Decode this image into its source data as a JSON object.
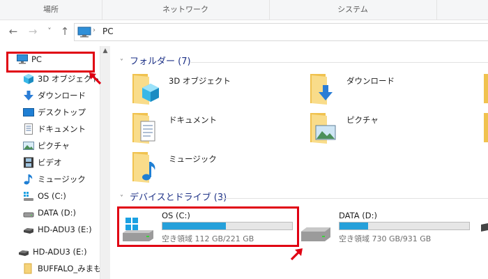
{
  "ribbon": {
    "tabs": [
      "場所",
      "ネットワーク",
      "システム"
    ]
  },
  "address": {
    "back_icon": "←",
    "forward_icon": "→",
    "history_icon": "˅",
    "up_icon": "↑",
    "path": "PC"
  },
  "sidebar": {
    "items": [
      {
        "label": "PC",
        "icon": "monitor-icon"
      },
      {
        "label": "3D オブジェクト",
        "icon": "cube-icon"
      },
      {
        "label": "ダウンロード",
        "icon": "download-arrow-icon"
      },
      {
        "label": "デスクトップ",
        "icon": "desktop-icon"
      },
      {
        "label": "ドキュメント",
        "icon": "document-icon"
      },
      {
        "label": "ピクチャ",
        "icon": "picture-icon"
      },
      {
        "label": "ビデオ",
        "icon": "film-icon"
      },
      {
        "label": "ミュージック",
        "icon": "music-note-icon"
      },
      {
        "label": "OS (C:)",
        "icon": "windows-drive-icon"
      },
      {
        "label": "DATA (D:)",
        "icon": "drive-icon"
      },
      {
        "label": "HD-ADU3 (E:)",
        "icon": "external-drive-icon"
      },
      {
        "label": "HD-ADU3 (E:)",
        "icon": "external-drive-icon"
      },
      {
        "label": "BUFFALO_みまも",
        "icon": "folder-icon"
      }
    ]
  },
  "folders_section": {
    "title": "フォルダー (7)",
    "items": [
      {
        "label": "3D オブジェクト"
      },
      {
        "label": "ダウンロード"
      },
      {
        "label": "ドキュメント"
      },
      {
        "label": "ピクチャ"
      },
      {
        "label": "ミュージック"
      }
    ]
  },
  "drives_section": {
    "title": "デバイスとドライブ (3)",
    "items": [
      {
        "name": "OS (C:)",
        "free_text": "空き領域 112 GB/221 GB",
        "used_fraction": 0.49
      },
      {
        "name": "DATA (D:)",
        "free_text": "空き領域 730 GB/931 GB",
        "used_fraction": 0.22
      }
    ]
  },
  "colors": {
    "highlight": "#e00012",
    "section_title": "#1e3287",
    "drive_fill": "#26a0da",
    "folder": "#f5d37a"
  }
}
